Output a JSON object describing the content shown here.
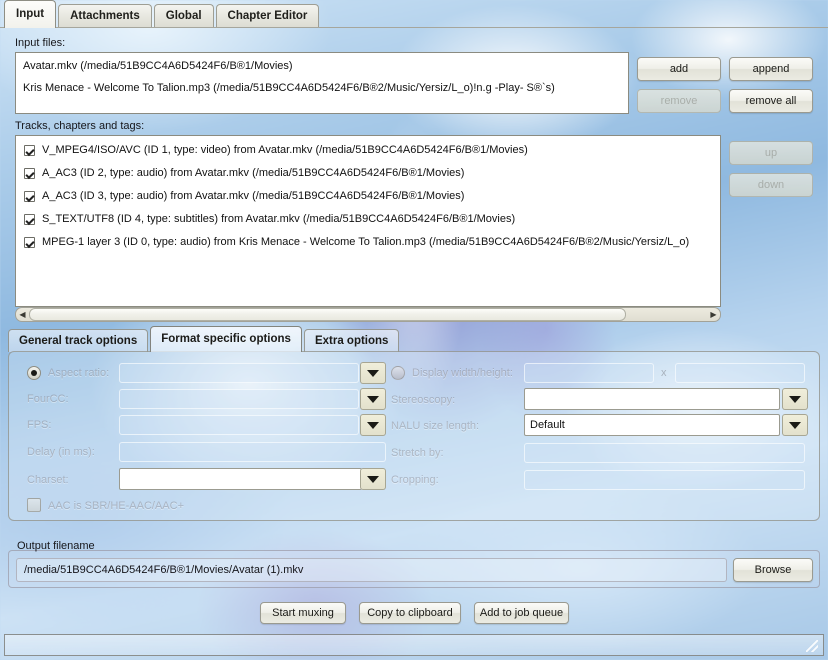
{
  "window": {
    "tabs": [
      {
        "label": "Input",
        "active": true
      },
      {
        "label": "Attachments",
        "active": false
      },
      {
        "label": "Global",
        "active": false
      },
      {
        "label": "Chapter Editor",
        "active": false
      }
    ]
  },
  "input_files": {
    "label": "Input files:",
    "items": [
      "Avatar.mkv (/media/51B9CC4A6D5424F6/B®1/Movies)",
      "Kris Menace - Welcome To Talion.mp3 (/media/51B9CC4A6D5424F6/B®2/Music/Yersiz/L_o)!n.g -Play- S®`s)"
    ],
    "buttons": {
      "add": "add",
      "append": "append",
      "remove": "remove",
      "remove_all": "remove all"
    }
  },
  "tracks": {
    "label": "Tracks, chapters and tags:",
    "items": [
      {
        "checked": true,
        "text": "V_MPEG4/ISO/AVC (ID 1, type: video) from Avatar.mkv (/media/51B9CC4A6D5424F6/B®1/Movies)"
      },
      {
        "checked": true,
        "text": "A_AC3 (ID 2, type: audio) from Avatar.mkv (/media/51B9CC4A6D5424F6/B®1/Movies)"
      },
      {
        "checked": true,
        "text": "A_AC3 (ID 3, type: audio) from Avatar.mkv (/media/51B9CC4A6D5424F6/B®1/Movies)"
      },
      {
        "checked": true,
        "text": "S_TEXT/UTF8 (ID 4, type: subtitles) from Avatar.mkv (/media/51B9CC4A6D5424F6/B®1/Movies)"
      },
      {
        "checked": true,
        "text": "MPEG-1 layer 3 (ID 0, type: audio) from Kris Menace - Welcome To Talion.mp3 (/media/51B9CC4A6D5424F6/B®2/Music/Yersiz/L_o)"
      }
    ],
    "buttons": {
      "up": "up",
      "down": "down"
    }
  },
  "options_tabs": [
    {
      "label": "General track options",
      "active": false
    },
    {
      "label": "Format specific options",
      "active": true
    },
    {
      "label": "Extra options",
      "active": false
    }
  ],
  "format_options": {
    "left": {
      "aspect_ratio_label": "Aspect ratio:",
      "aspect_ratio_value": "",
      "fourcc_label": "FourCC:",
      "fourcc_value": "",
      "fps_label": "FPS:",
      "fps_value": "",
      "delay_label": "Delay (in ms):",
      "delay_value": "",
      "charset_label": "Charset:",
      "charset_value": "",
      "aac_checkbox_label": "AAC is SBR/HE-AAC/AAC+"
    },
    "right": {
      "display_wh_label": "Display width/height:",
      "display_width_value": "",
      "display_separator": "x",
      "display_height_value": "",
      "stereoscopy_label": "Stereoscopy:",
      "stereoscopy_value": "",
      "nalu_label": "NALU size length:",
      "nalu_value": "Default",
      "stretch_label": "Stretch by:",
      "stretch_value": "",
      "cropping_label": "Cropping:",
      "cropping_value": ""
    }
  },
  "output": {
    "group_title": "Output filename",
    "filename": "/media/51B9CC4A6D5424F6/B®1/Movies/Avatar (1).mkv",
    "browse_label": "Browse"
  },
  "actions": {
    "start_muxing": "Start muxing",
    "copy_to_clipboard": "Copy to clipboard",
    "add_to_job_queue": "Add to job queue"
  },
  "statusbar": {
    "text": ""
  },
  "colors": {
    "accent": "#8fb9e0",
    "list_bg": "#ffffff",
    "button_face": "#eceae0"
  }
}
